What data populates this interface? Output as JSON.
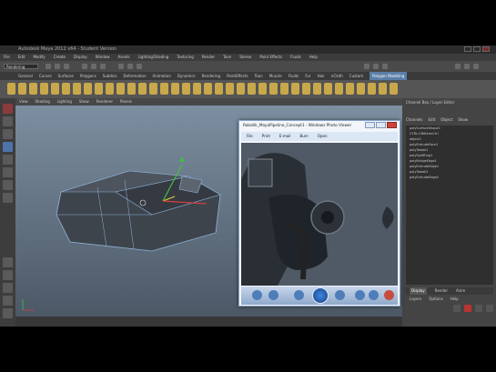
{
  "window": {
    "title": "Autodesk Maya 2012 x64 - Student Version"
  },
  "menubar": {
    "items": [
      "File",
      "Edit",
      "Modify",
      "Create",
      "Display",
      "Window",
      "Assets",
      "Lighting/Shading",
      "Texturing",
      "Render",
      "Toon",
      "Stereo",
      "Paint Effects",
      "Fluids",
      "Help"
    ]
  },
  "statusline": {
    "mode": "Rendering"
  },
  "shelf": {
    "tabs": [
      "General",
      "Curves",
      "Surfaces",
      "Polygons",
      "Subdivs",
      "Deformation",
      "Animation",
      "Dynamics",
      "Rendering",
      "PaintEffects",
      "Toon",
      "Muscle",
      "Fluids",
      "Fur",
      "Hair",
      "nCloth",
      "Custom",
      "Polygon Modeling"
    ],
    "active_tab": "Polygon Modeling"
  },
  "viewport": {
    "menu": [
      "View",
      "Shading",
      "Lighting",
      "Show",
      "Renderer",
      "Panels"
    ]
  },
  "channel_box": {
    "title": "Channel Box / Layer Editor",
    "tabs": [
      "Channels",
      "Edit",
      "Object",
      "Show"
    ],
    "outliner": [
      "polySurfaceShape1",
      "CTRL:CBIKArmCtrl",
      "object1",
      "polyExtrudeFace1",
      "polyTweak1",
      "polySplitRing1",
      "polyBridgeEdge1",
      "polyExtrudeEdge1",
      "polyTweak2",
      "polyExtrudeEdge2"
    ],
    "layer_tabs": [
      "Display",
      "Render",
      "Anim"
    ],
    "layer_active": "Display",
    "layer_menu": [
      "Layers",
      "Options",
      "Help"
    ]
  },
  "photo_viewer": {
    "title": "Robotik_MayaPipeline_Concept1 - Windows Photo Viewer",
    "menu": [
      "File",
      "Print",
      "E-mail",
      "Burn",
      "Open"
    ]
  }
}
